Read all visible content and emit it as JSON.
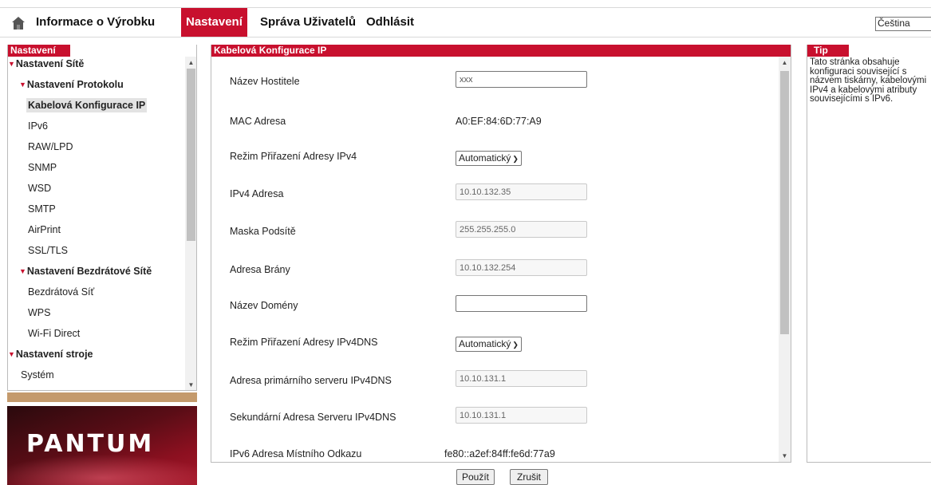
{
  "nav": {
    "items": [
      {
        "label": "Informace o Výrobku"
      },
      {
        "label": "Nastavení"
      },
      {
        "label": "Správa Uživatelů"
      },
      {
        "label": "Odhlásit"
      }
    ],
    "active": "Nastavení",
    "language": "Čeština",
    "home_icon": "home-icon"
  },
  "sidebar": {
    "title": "Nastavení",
    "items": [
      {
        "label": "Nastavení Sítě",
        "expanded": true
      },
      {
        "label": "Nastavení Protokolu",
        "expanded": true
      },
      {
        "label": "Kabelová Konfigurace IP",
        "selected": true
      },
      {
        "label": "IPv6"
      },
      {
        "label": "RAW/LPD"
      },
      {
        "label": "SNMP"
      },
      {
        "label": "WSD"
      },
      {
        "label": "SMTP"
      },
      {
        "label": "AirPrint"
      },
      {
        "label": "SSL/TLS"
      },
      {
        "label": "Nastavení Bezdrátové Sítě",
        "expanded": true
      },
      {
        "label": "Bezdrátová Síť"
      },
      {
        "label": "WPS"
      },
      {
        "label": "Wi-Fi Direct"
      },
      {
        "label": "Nastavení stroje",
        "expanded": true
      },
      {
        "label": "Systém"
      }
    ]
  },
  "brand": {
    "logo_text": "PANTUM"
  },
  "main": {
    "title": "Kabelová Konfigurace IP",
    "fields": [
      {
        "label": "Název Hostitele",
        "value": "xxx"
      },
      {
        "label": "MAC Adresa",
        "value": "A0:EF:84:6D:77:A9"
      },
      {
        "label": "Režim Přiřazení Adresy IPv4",
        "value": "Automatický"
      },
      {
        "label": "IPv4 Adresa",
        "value": "10.10.132.35"
      },
      {
        "label": "Maska Podsítě",
        "value": "255.255.255.0"
      },
      {
        "label": "Adresa Brány",
        "value": "10.10.132.254"
      },
      {
        "label": "Název Domény",
        "value": ""
      },
      {
        "label": "Režim Přiřazení Adresy IPv4DNS",
        "value": "Automatický"
      },
      {
        "label": "Adresa primárního serveru IPv4DNS",
        "value": "10.10.131.1"
      },
      {
        "label": "Sekundární Adresa Serveru IPv4DNS",
        "value": "10.10.131.1"
      },
      {
        "label": "IPv6 Adresa Místního Odkazu",
        "value": "fe80::a2ef:84ff:fe6d:77a9"
      }
    ]
  },
  "buttons": {
    "apply": "Použít",
    "cancel": "Zrušit"
  },
  "tip": {
    "title": "Tip",
    "text": "Tato stránka obsahuje konfiguraci související s názvem tiskárny, kabelovými IPv4 a kabelovými atributy souvisejícími s IPv6."
  },
  "colors": {
    "accent": "#c8102e",
    "brand_strip": "#c49a6c"
  }
}
